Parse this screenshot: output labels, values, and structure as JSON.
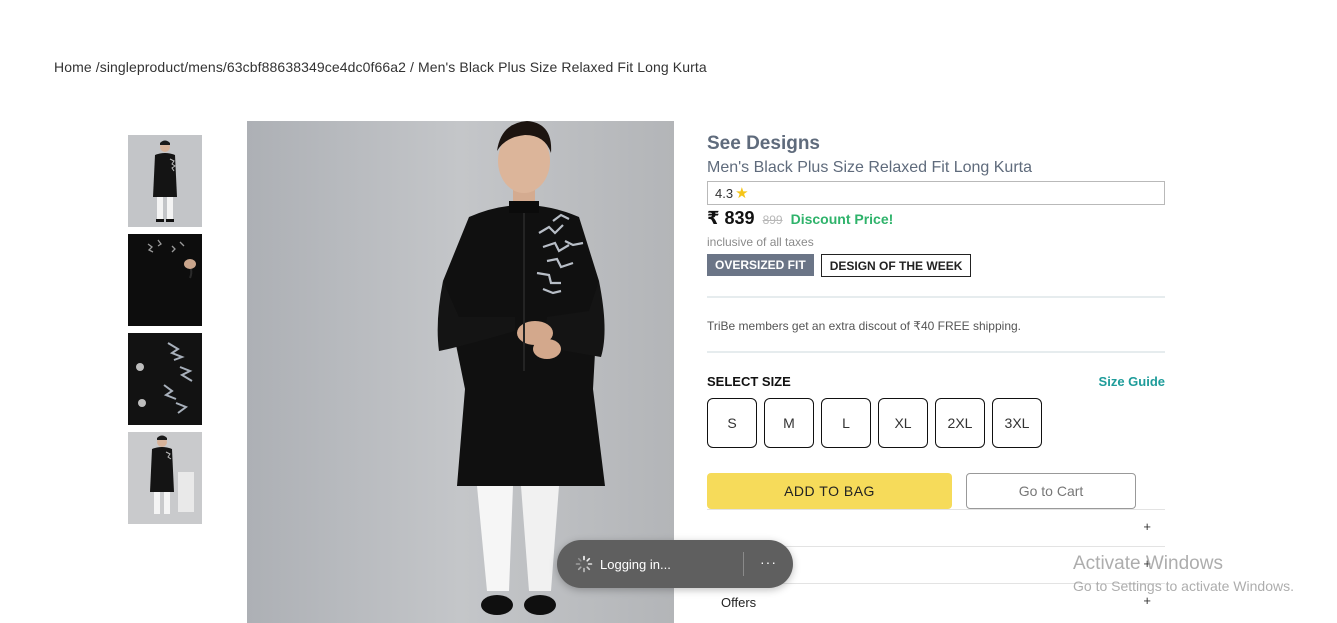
{
  "breadcrumb": {
    "text": "Home /singleproduct/mens/63cbf88638349ce4dc0f66a2 / Men's Black Plus Size Relaxed Fit Long Kurta"
  },
  "product": {
    "brand": "See Designs",
    "title": "Men's Black Plus Size Relaxed Fit Long Kurta",
    "rating": "4.3",
    "price": "₹ 839",
    "mrp": "899",
    "discount_label": "Discount Price!",
    "tax_note": "inclusive of all taxes",
    "tags": [
      "OVERSIZED FIT",
      "DESIGN OF THE WEEK"
    ],
    "tribe_note": "TriBe members get an extra discout of ₹40 FREE shipping.",
    "select_size_label": "SELECT SIZE",
    "size_guide_label": "Size Guide",
    "sizes": [
      "S",
      "M",
      "L",
      "XL",
      "2XL",
      "3XL"
    ],
    "add_to_bag_label": "ADD TO BAG",
    "go_to_cart_label": "Go to Cart",
    "accordions": [
      {
        "label": "",
        "icon": "+"
      },
      {
        "label": "",
        "icon": "+"
      },
      {
        "label": "Offers",
        "icon": "+"
      }
    ]
  },
  "toast": {
    "text": "Logging in...",
    "more": "···"
  },
  "watermark": {
    "line1": "Activate Windows",
    "line2": "Go to Settings to activate Windows."
  },
  "colors": {
    "accent_yellow": "#f6db5a",
    "discount_green": "#2fb36b",
    "size_guide_teal": "#1e9c9a",
    "tag_fill": "#6b7587"
  }
}
